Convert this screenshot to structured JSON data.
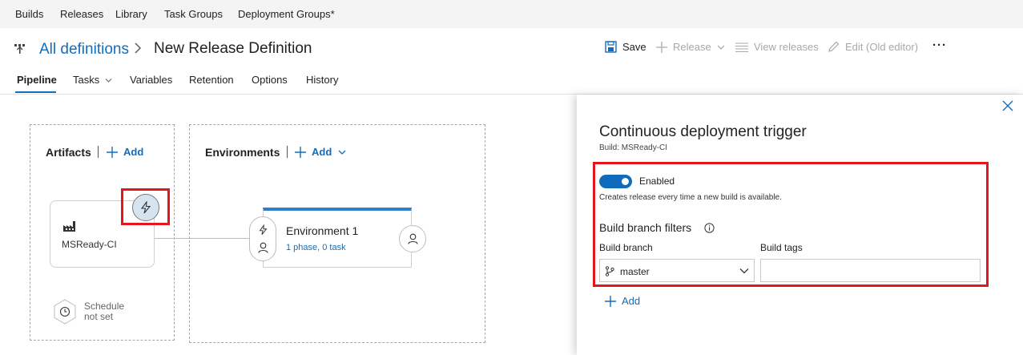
{
  "topnav": {
    "items": [
      "Builds",
      "Releases",
      "Library",
      "Task Groups",
      "Deployment Groups*"
    ]
  },
  "header": {
    "breadcrumb_link": "All definitions",
    "title": "New Release Definition"
  },
  "toolbar": {
    "save_label": "Save",
    "release_label": "Release",
    "view_releases_label": "View releases",
    "edit_old_label": "Edit (Old editor)",
    "more_label": "···"
  },
  "tabs": {
    "items": [
      "Pipeline",
      "Tasks",
      "Variables",
      "Retention",
      "Options",
      "History"
    ],
    "active": "Pipeline"
  },
  "pipeline": {
    "artifacts": {
      "title": "Artifacts",
      "add_label": "Add",
      "artifact_name": "MSReady-CI",
      "schedule_text": "Schedule not set"
    },
    "environments": {
      "title": "Environments",
      "add_label": "Add",
      "environment": {
        "name": "Environment 1",
        "summary": "1 phase, 0 task"
      }
    }
  },
  "panel": {
    "title": "Continuous deployment trigger",
    "subtitle": "Build: MSReady-CI",
    "toggle": {
      "label": "Enabled",
      "on": true,
      "description": "Creates release every time a new build is available."
    },
    "filters_title": "Build branch filters",
    "branch_label": "Build branch",
    "branch_value": "master",
    "tags_label": "Build tags",
    "tags_value": "",
    "add_label": "Add"
  },
  "colors": {
    "accent": "#106ebe",
    "highlight": "#e4171f",
    "toggle_on": "#0f6cbd",
    "env_bar": "#2f7fd0"
  }
}
